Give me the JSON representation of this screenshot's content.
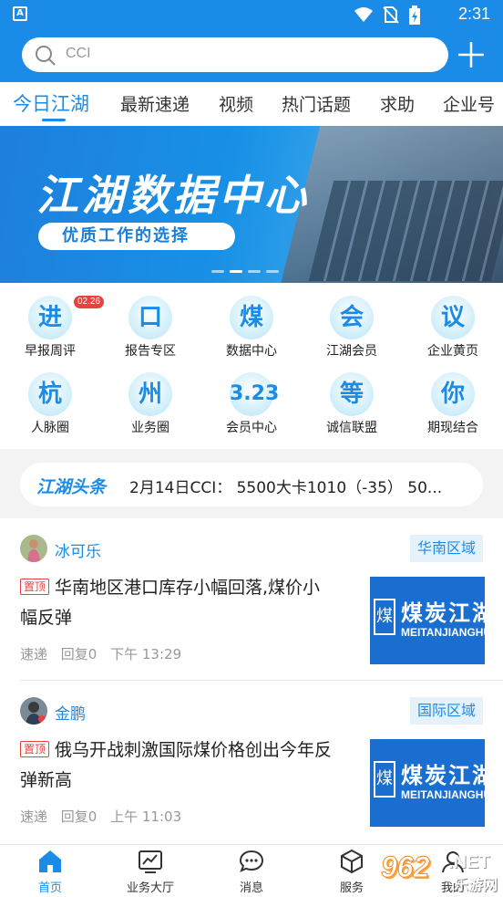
{
  "status_bar": {
    "time": "2:31",
    "left_icon_letter": "A"
  },
  "search": {
    "placeholder": "CCI"
  },
  "tabs": [
    "今日江湖",
    "最新速递",
    "视频",
    "热门话题",
    "求助",
    "企业号"
  ],
  "banner": {
    "title": "江湖数据中心",
    "subtitle": "优质工作的选择",
    "slide_count": 4,
    "active_slide": 2
  },
  "grid": [
    {
      "glyph": "进",
      "label": "早报周评",
      "badge": "02.26"
    },
    {
      "glyph": "口",
      "label": "报告专区"
    },
    {
      "glyph": "煤",
      "label": "数据中心"
    },
    {
      "glyph": "会",
      "label": "江湖会员"
    },
    {
      "glyph": "议",
      "label": "企业黄页"
    },
    {
      "glyph": "杭",
      "label": "人脉圈"
    },
    {
      "glyph": "州",
      "label": "业务圈"
    },
    {
      "glyph": "3.23",
      "label": "会员中心"
    },
    {
      "glyph": "等",
      "label": "诚信联盟"
    },
    {
      "glyph": "你",
      "label": "期现结合"
    }
  ],
  "headline": {
    "tag": "江湖头条",
    "text": "2月14日CCI： 5500大卡1010（-35） 50..."
  },
  "posts": [
    {
      "author": "冰可乐",
      "region": "华南区域",
      "top_tag": "置顶",
      "title": "华南地区港口库存小幅回落,煤价小幅反弹",
      "meta": [
        "速递",
        "回复0",
        "下午 13:29"
      ],
      "thumb": {
        "mark": "煤",
        "name": "煤炭江湖",
        "en": "MEITANJIANGHU"
      }
    },
    {
      "author": "金鹏",
      "region": "国际区域",
      "top_tag": "置顶",
      "title": "俄乌开战刺激国际煤价格创出今年反弹新高",
      "meta": [
        "速递",
        "回复0",
        "上午 11:03"
      ],
      "thumb": {
        "mark": "煤",
        "name": "煤炭江湖",
        "en": "MEITANJIANGHU"
      }
    }
  ],
  "bottom_nav": [
    {
      "label": "首页",
      "icon": "home-icon",
      "active": true
    },
    {
      "label": "业务大厅",
      "icon": "chart-icon"
    },
    {
      "label": "消息",
      "icon": "chat-icon"
    },
    {
      "label": "服务",
      "icon": "cube-icon"
    },
    {
      "label": "我的",
      "icon": "user-icon"
    }
  ],
  "watermark": {
    "num": "962",
    "net": ".NET",
    "cn": "乐游网"
  },
  "colors": {
    "primary": "#1a8ce8",
    "badge_red": "#e9413e",
    "separator": "#f3f3f3"
  }
}
